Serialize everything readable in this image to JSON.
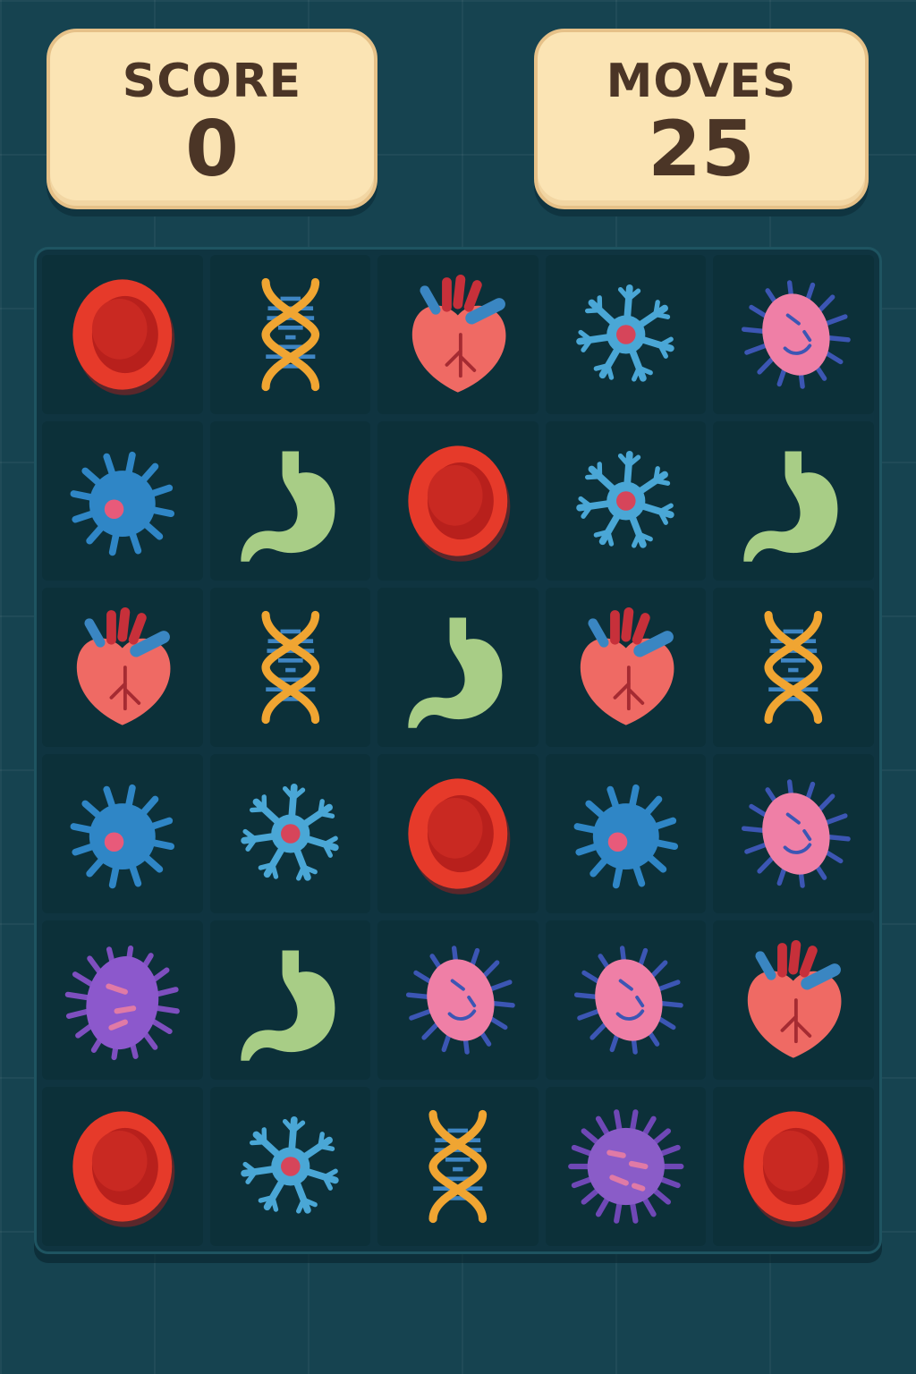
{
  "hud": {
    "score_label": "SCORE",
    "score_value": "0",
    "moves_label": "MOVES",
    "moves_value": "25"
  },
  "board": {
    "rows": 6,
    "cols": 5,
    "grid": [
      [
        "red-blood-cell",
        "dna",
        "heart",
        "neuron",
        "pink-germ"
      ],
      [
        "blue-cell",
        "stomach",
        "red-blood-cell",
        "neuron",
        "stomach"
      ],
      [
        "heart",
        "dna",
        "stomach",
        "heart",
        "dna"
      ],
      [
        "blue-cell",
        "neuron",
        "red-blood-cell",
        "blue-cell",
        "pink-germ"
      ],
      [
        "purple-bacteria",
        "stomach",
        "pink-germ",
        "pink-germ",
        "heart"
      ],
      [
        "red-blood-cell",
        "neuron",
        "dna",
        "purple-virus",
        "red-blood-cell"
      ]
    ]
  },
  "colors": {
    "background": "#164350",
    "board": "#0f3440",
    "tile": "#0c3039",
    "panel": "#fbe4b4",
    "panel_text": "#4b3526"
  }
}
